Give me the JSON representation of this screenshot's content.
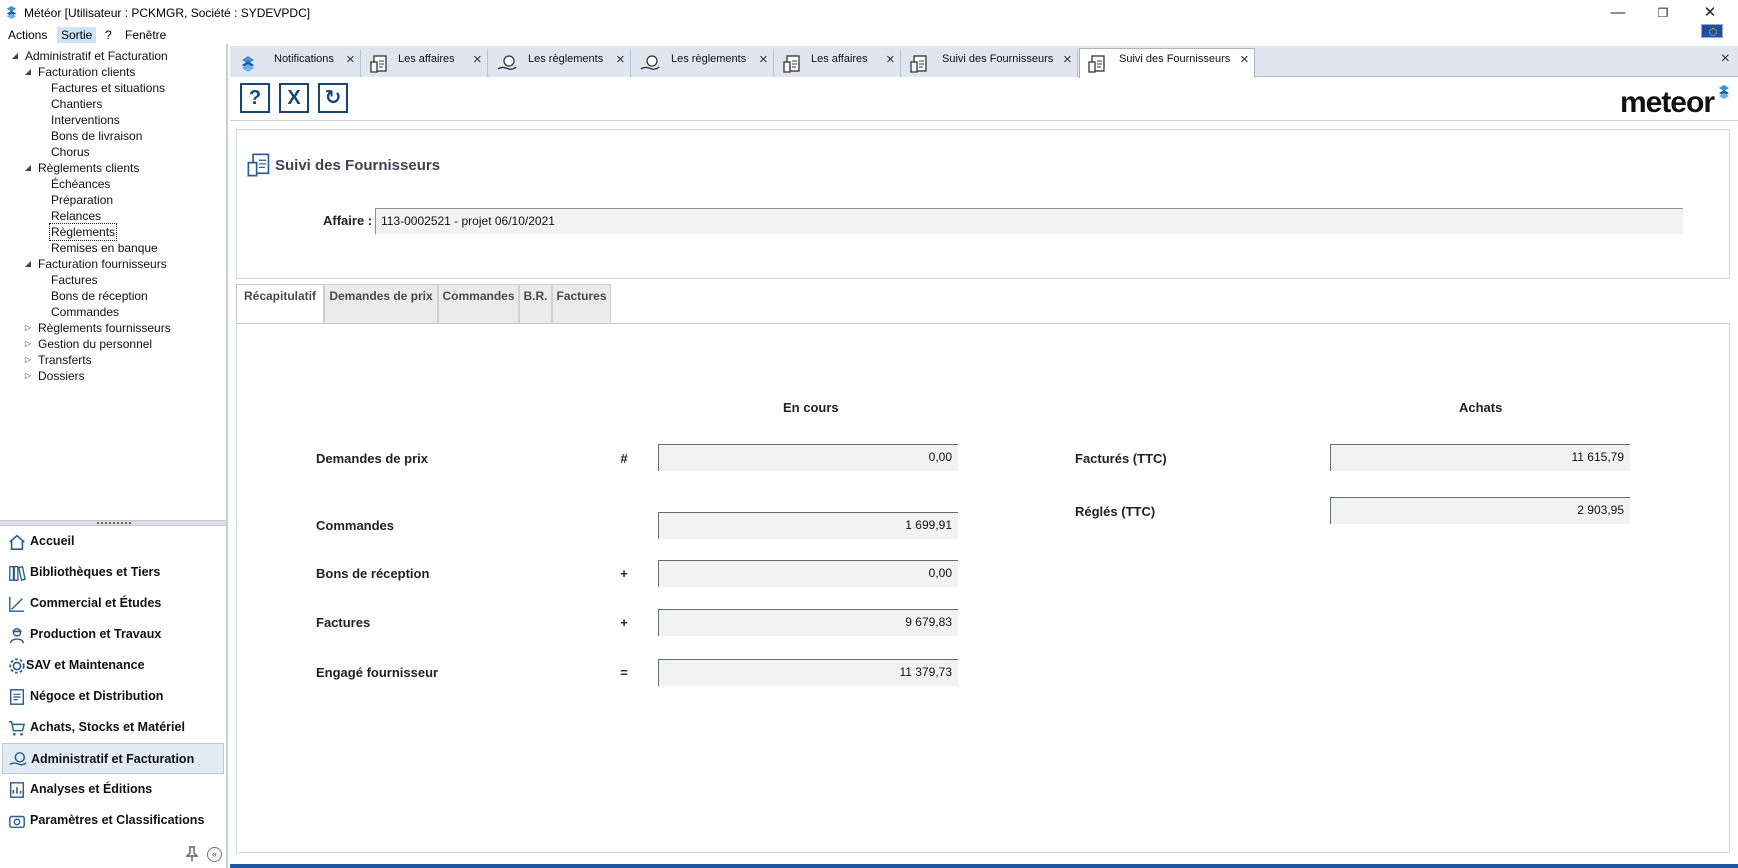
{
  "window": {
    "title": "Météor [Utilisateur : PCKMGR, Société : SYDEVPDC]",
    "minimize": "—",
    "restore": "❐",
    "close": "✕"
  },
  "menu": {
    "items": [
      "Actions",
      "Sortie",
      "?",
      "Fenêtre"
    ],
    "active_index": 1
  },
  "tree": {
    "items": [
      {
        "label": "Administratif et Facturation",
        "level": 0,
        "toggle": "◢"
      },
      {
        "label": "Facturation clients",
        "level": 1,
        "toggle": "◢"
      },
      {
        "label": "Factures et situations",
        "level": 2,
        "toggle": ""
      },
      {
        "label": "Chantiers",
        "level": 2,
        "toggle": ""
      },
      {
        "label": "Interventions",
        "level": 2,
        "toggle": ""
      },
      {
        "label": "Bons de livraison",
        "level": 2,
        "toggle": ""
      },
      {
        "label": "Chorus",
        "level": 2,
        "toggle": ""
      },
      {
        "label": "Règlements clients",
        "level": 1,
        "toggle": "◢"
      },
      {
        "label": "Échéances",
        "level": 2,
        "toggle": ""
      },
      {
        "label": "Préparation",
        "level": 2,
        "toggle": ""
      },
      {
        "label": "Relances",
        "level": 2,
        "toggle": ""
      },
      {
        "label": "Règlements",
        "level": 2,
        "toggle": "",
        "selected": true
      },
      {
        "label": "Remises en banque",
        "level": 2,
        "toggle": ""
      },
      {
        "label": "Facturation fournisseurs",
        "level": 1,
        "toggle": "◢"
      },
      {
        "label": "Factures",
        "level": 2,
        "toggle": ""
      },
      {
        "label": "Bons de réception",
        "level": 2,
        "toggle": ""
      },
      {
        "label": "Commandes",
        "level": 2,
        "toggle": ""
      },
      {
        "label": "Règlements fournisseurs",
        "level": 1,
        "toggle": "▷"
      },
      {
        "label": "Gestion du personnel",
        "level": 1,
        "toggle": "▷"
      },
      {
        "label": "Transferts",
        "level": 1,
        "toggle": "▷"
      },
      {
        "label": "Dossiers",
        "level": 1,
        "toggle": "▷"
      }
    ]
  },
  "modules": {
    "items": [
      {
        "label": "Accueil",
        "icon": "home-icon"
      },
      {
        "label": "Bibliothèques et Tiers",
        "icon": "books-icon"
      },
      {
        "label": "Commercial et Études",
        "icon": "chart-ruler-icon"
      },
      {
        "label": "Production et Travaux",
        "icon": "worker-icon"
      },
      {
        "label": "SAV et Maintenance",
        "icon": "gear-icon"
      },
      {
        "label": "Négoce et Distribution",
        "icon": "document-icon"
      },
      {
        "label": "Achats, Stocks et Matériel",
        "icon": "cart-icon"
      },
      {
        "label": "Administratif et Facturation",
        "icon": "hand-coin-icon",
        "active": true
      },
      {
        "label": "Analyses et Éditions",
        "icon": "report-icon"
      },
      {
        "label": "Paramètres et Classifications",
        "icon": "settings-icon"
      }
    ]
  },
  "tabs": {
    "items": [
      {
        "label": "Notifications",
        "icon": "meteor-icon"
      },
      {
        "label": "Les affaires",
        "icon": "folder-doc-icon"
      },
      {
        "label": "Les règlements",
        "icon": "hand-coin-icon"
      },
      {
        "label": "Les règlements",
        "icon": "hand-coin-icon"
      },
      {
        "label": "Les affaires",
        "icon": "folder-doc-icon"
      },
      {
        "label": "Suivi des Fournisseurs",
        "icon": "folder-doc-icon"
      },
      {
        "label": "Suivi des Fournisseurs",
        "icon": "folder-doc-icon",
        "active": true
      }
    ],
    "close_glyph": "×"
  },
  "toolbar": {
    "help": "?",
    "cancel": "X",
    "refresh": "↻"
  },
  "logo": {
    "text": "meteor"
  },
  "panel": {
    "title": "Suivi des Fournisseurs",
    "affaire_label": "Affaire :",
    "affaire_value": "113-0002521 - projet 06/10/2021"
  },
  "subtabs": {
    "items": [
      "Récapitulatif",
      "Demandes de prix",
      "Commandes",
      "B.R.",
      "Factures"
    ],
    "active_index": 0
  },
  "summary": {
    "en_cours_header": "En cours",
    "achats_header": "Achats",
    "en_cours": [
      {
        "label": "Demandes de prix",
        "op": "#",
        "value": "0,00"
      },
      {
        "label": "Commandes",
        "op": "",
        "value": "1 699,91"
      },
      {
        "label": "Bons de réception",
        "op": "+",
        "value": "0,00"
      },
      {
        "label": "Factures",
        "op": "+",
        "value": "9 679,83"
      },
      {
        "label": "Engagé fournisseur",
        "op": "=",
        "value": "11 379,73"
      }
    ],
    "achats": [
      {
        "label": "Facturés (TTC)",
        "value": "11 615,79"
      },
      {
        "label": "Réglés (TTC)",
        "value": "2 903,95"
      }
    ]
  },
  "colors": {
    "accent": "#17457a",
    "tab_strip": "#dfe6ef",
    "active_module": "#e3ebf5",
    "field_bg": "#f2f2f2"
  }
}
